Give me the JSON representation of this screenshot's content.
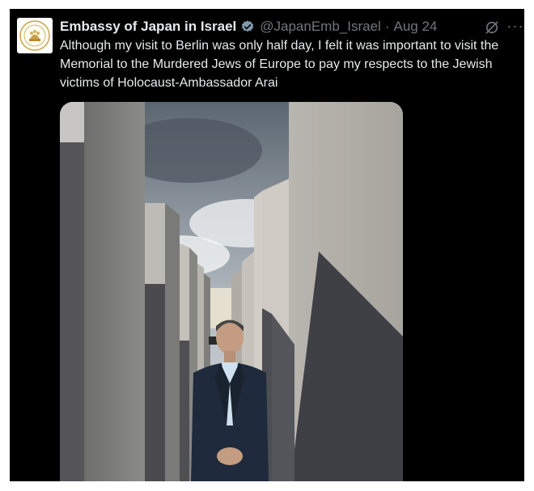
{
  "tweet": {
    "author_name": "Embassy of Japan in Israel",
    "handle": "@JapanEmb_Israel",
    "separator": "·",
    "date": "Aug 24",
    "text": "Although my visit to Berlin was only half day, I felt it was important to visit the Memorial to the Murdered Jews of Europe to pay my respects to the Jewish victims of Holocaust-Ambassador Arai",
    "more_label": "···"
  },
  "icons": {
    "avatar": "embassy-emblem-icon",
    "verified": "verified-badge-icon",
    "grok": "grok-icon",
    "more": "more-options-icon"
  },
  "colors": {
    "background": "#000000",
    "primary_text": "#e7e9ea",
    "secondary_text": "#71767b",
    "verified_badge": "#829aab"
  }
}
